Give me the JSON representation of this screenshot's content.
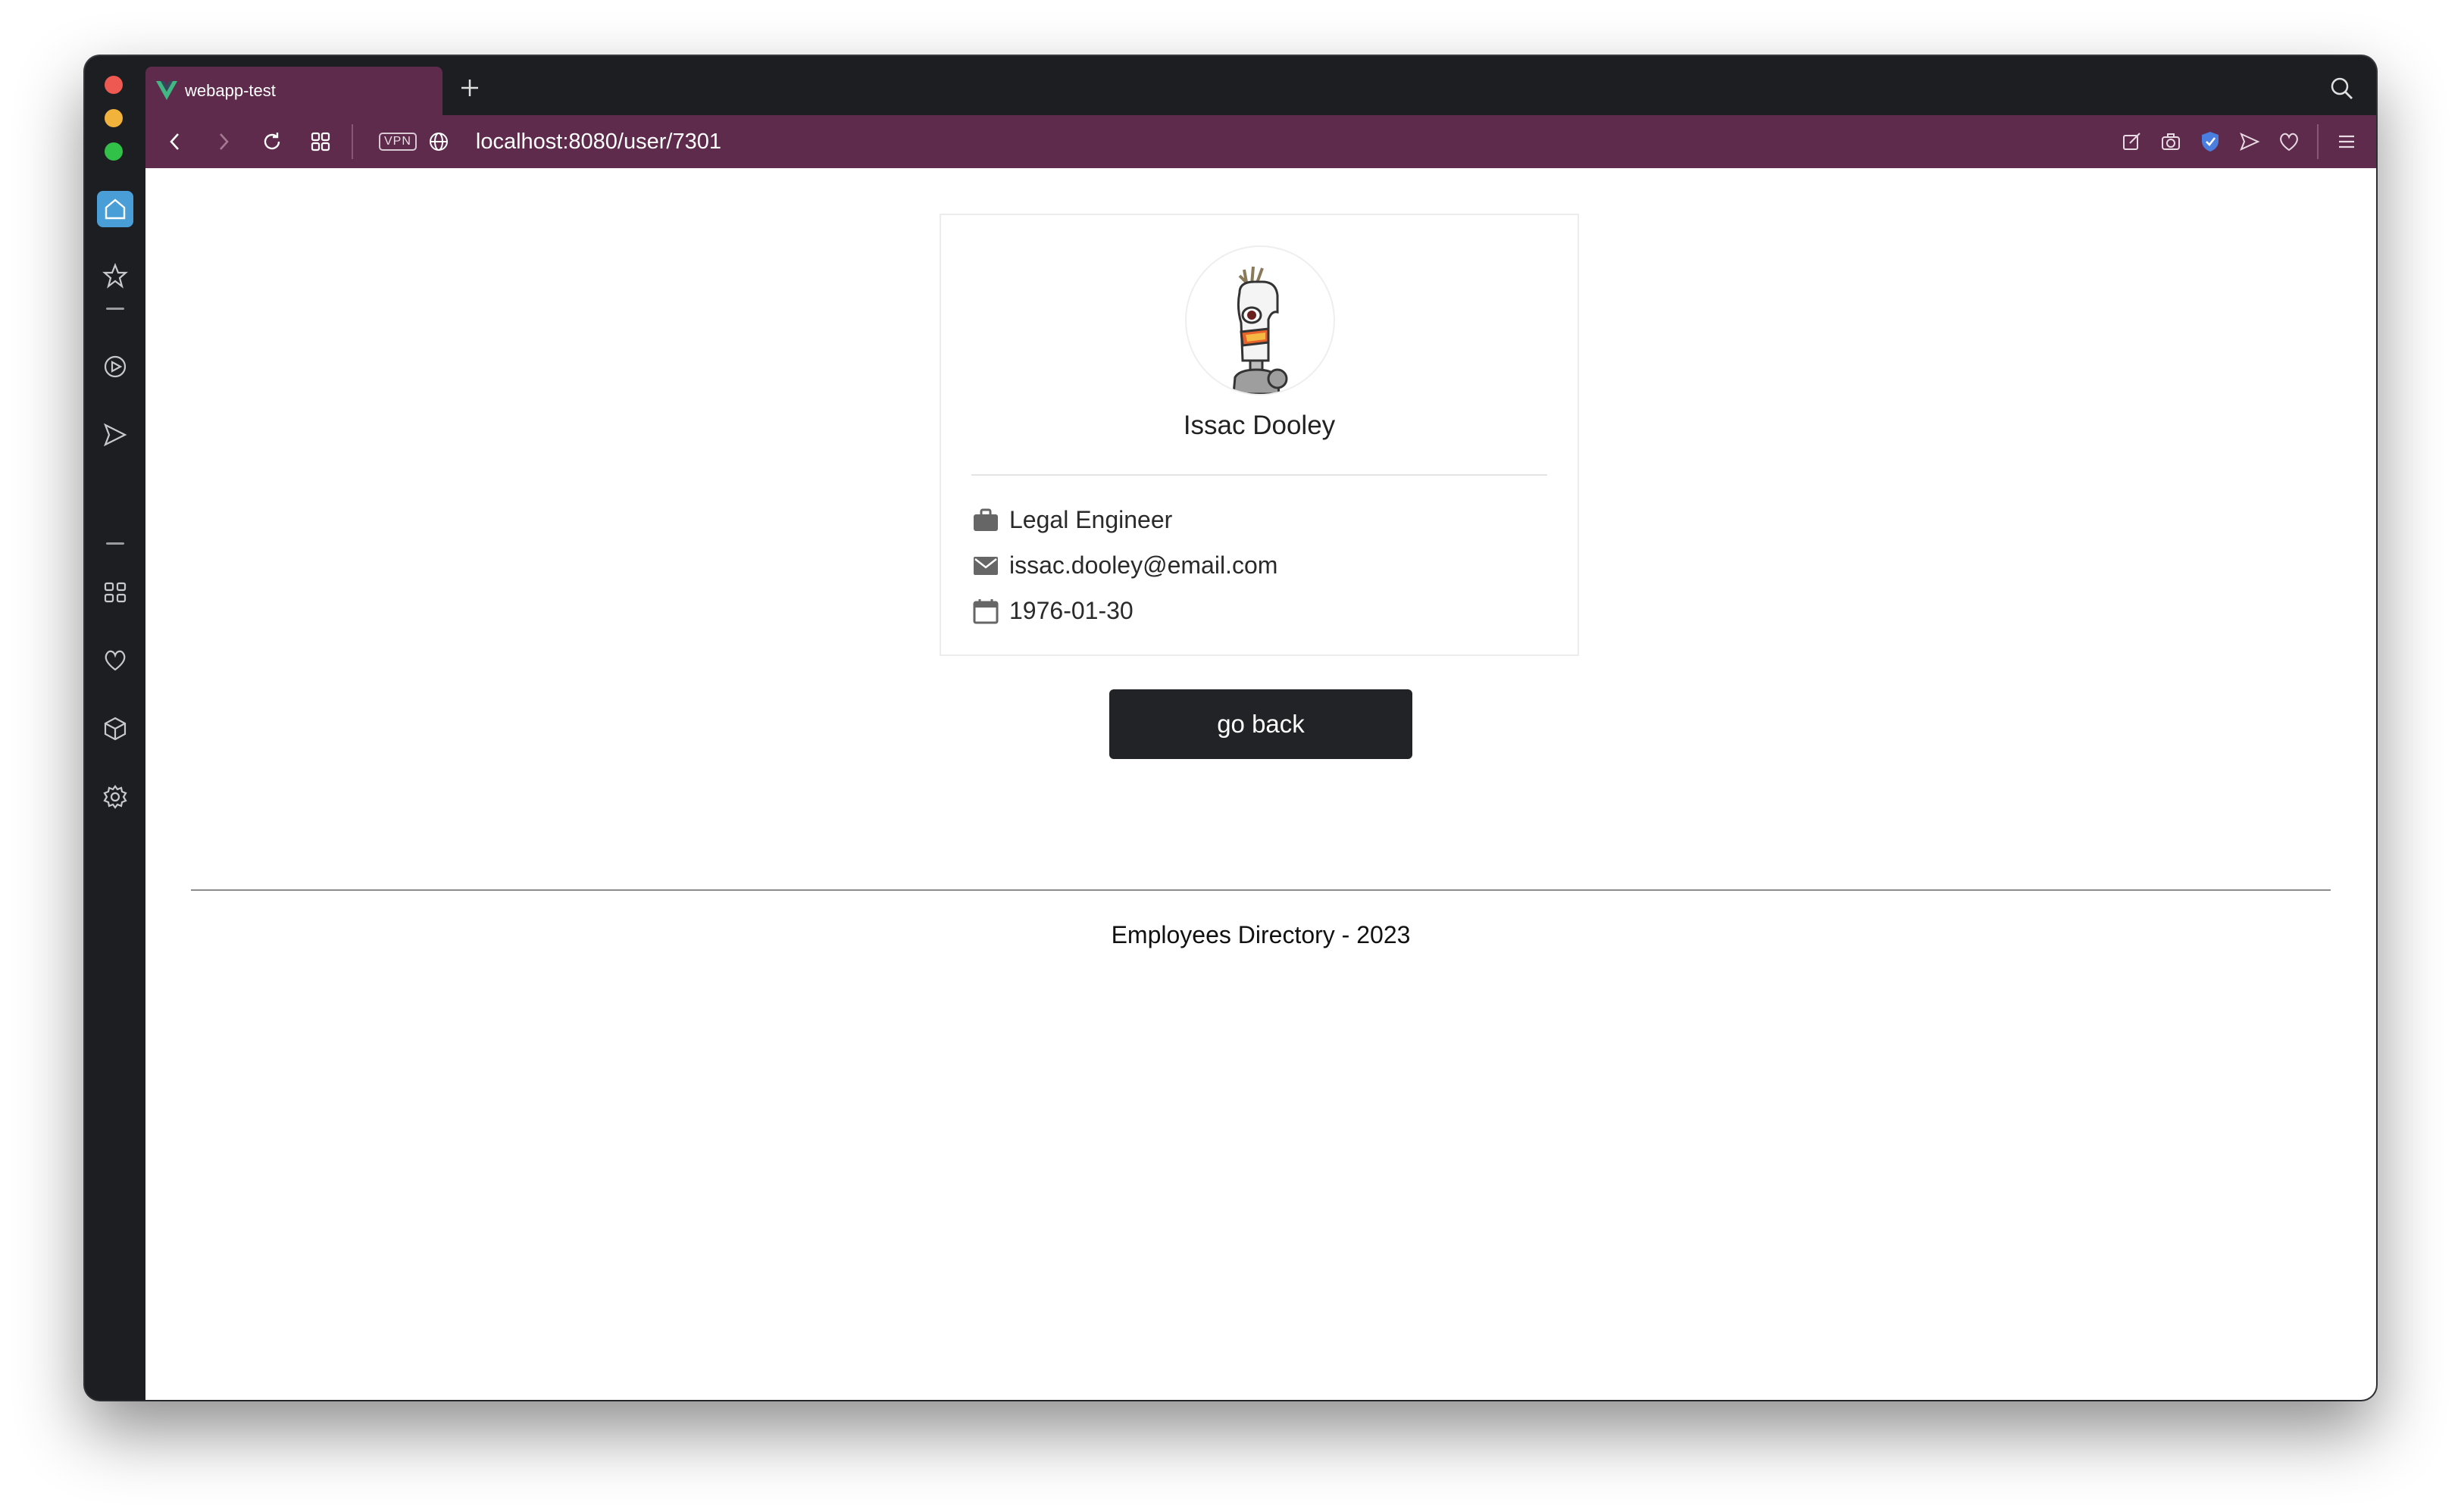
{
  "browser": {
    "tab": {
      "title": "webapp-test"
    },
    "address_bar": {
      "url": "localhost:8080/user/7301",
      "vpn_label": "VPN"
    }
  },
  "profile": {
    "name": "Issac Dooley",
    "job_title": "Legal Engineer",
    "email": "issac.dooley@email.com",
    "birth_date": "1976-01-30"
  },
  "actions": {
    "back_label": "go back"
  },
  "footer": {
    "text": "Employees Directory - 2023"
  },
  "colors": {
    "tab_accent": "#5f2b4c",
    "chrome_dark": "#1c1e22",
    "button_dark": "#212326",
    "home_active": "#4a9ed8"
  }
}
